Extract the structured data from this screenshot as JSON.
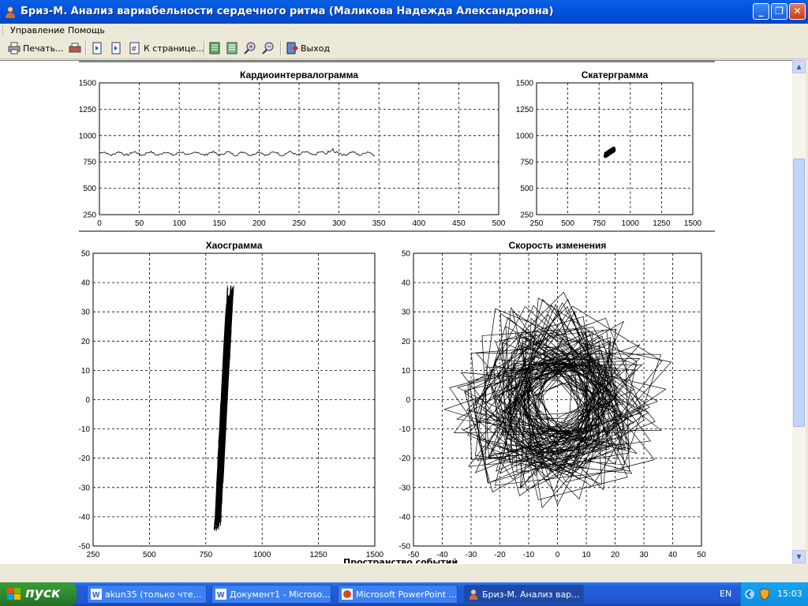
{
  "window": {
    "title": "Бриз-М. Анализ вариабельности сердечного ритма (Маликова Надежда Александровна)",
    "minimize": "_",
    "maximize": "❐",
    "close": "✕"
  },
  "menu": [
    "Управление",
    "Помощь"
  ],
  "toolbar": {
    "print_label": "Печать...",
    "goto_page_label": "К странице...",
    "exit_label": "Выход"
  },
  "charts": {
    "cardio": {
      "title": "Кардиоинтервалограмма",
      "x_ticks": [
        "0",
        "50",
        "100",
        "150",
        "200",
        "250",
        "300",
        "350",
        "400",
        "450",
        "500"
      ],
      "y_ticks": [
        "1500",
        "1250",
        "1000",
        "750",
        "500",
        "250"
      ]
    },
    "scatter": {
      "title": "Скатерграмма",
      "x_ticks": [
        "250",
        "500",
        "750",
        "1000",
        "1250",
        "1500"
      ],
      "y_ticks": [
        "1500",
        "1250",
        "1000",
        "750",
        "500",
        "250"
      ]
    },
    "chaos": {
      "title": "Хаосграмма",
      "x_ticks": [
        "250",
        "500",
        "750",
        "1000",
        "1250",
        "1500"
      ],
      "y_ticks": [
        "50",
        "40",
        "30",
        "20",
        "10",
        "0",
        "-10",
        "-20",
        "-30",
        "-40",
        "-50"
      ]
    },
    "speed": {
      "title": "Скорость изменения",
      "x_ticks": [
        "-50",
        "-40",
        "-30",
        "-20",
        "-10",
        "0",
        "10",
        "20",
        "30",
        "40",
        "50"
      ],
      "y_ticks": [
        "50",
        "40",
        "30",
        "20",
        "10",
        "0",
        "-10",
        "-20",
        "-30",
        "-40",
        "-50"
      ]
    },
    "bottom_label": "Пространство событий"
  },
  "chart_data": [
    {
      "type": "line",
      "title": "Кардиоинтервалограмма",
      "xlim": [
        0,
        500
      ],
      "ylim": [
        250,
        1500
      ],
      "series": [
        {
          "x_range": [
            0,
            345
          ],
          "mean": 830,
          "amplitude": 25
        }
      ],
      "grid": true
    },
    {
      "type": "scatter",
      "title": "Скатерграмма",
      "xlim": [
        250,
        1500
      ],
      "ylim": [
        250,
        1500
      ],
      "cluster": {
        "x_range": [
          800,
          870
        ],
        "y_range": [
          800,
          880
        ]
      },
      "grid": true
    },
    {
      "type": "scatter",
      "title": "Хаосграмма",
      "xlim": [
        250,
        1500
      ],
      "ylim": [
        -50,
        50
      ],
      "cluster": {
        "x_range": [
          800,
          870
        ],
        "y_range": [
          -45,
          39
        ]
      },
      "grid": true
    },
    {
      "type": "line",
      "title": "Скорость изменения",
      "xlim": [
        -50,
        50
      ],
      "ylim": [
        -50,
        50
      ],
      "extent": {
        "x_range": [
          -45,
          40
        ],
        "y_range": [
          -45,
          38
        ]
      },
      "grid": true
    }
  ],
  "taskbar": {
    "start": "пуск",
    "tasks": [
      "akun35 (только чте...",
      "Документ1 - Microso...",
      "Microsoft PowerPoint ...",
      "Бриз-М. Анализ вар..."
    ],
    "lang": "EN",
    "clock": "15:03"
  }
}
